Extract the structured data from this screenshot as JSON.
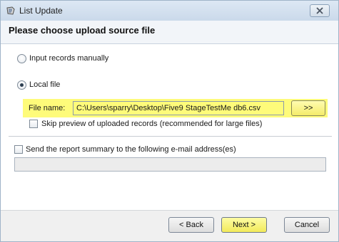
{
  "window": {
    "title": "List Update",
    "header": "Please choose upload source file"
  },
  "source": {
    "option_manual": "Input records manually",
    "option_local": "Local file",
    "selected": "Local file",
    "file_name_label": "File name:",
    "file_name_value": "C:\\Users\\sparry\\Desktop\\Five9 StageTestMe db6.csv",
    "browse_label": ">>",
    "skip_preview_label": "Skip preview of uploaded records (recommended for large files)",
    "skip_preview_checked": false
  },
  "report": {
    "send_summary_label": "Send the report summary to the following e-mail address(es)",
    "send_summary_checked": false,
    "email_value": ""
  },
  "footer": {
    "back_label": "< Back",
    "next_label": "Next >",
    "cancel_label": "Cancel"
  },
  "colors": {
    "highlight": "#fefb7a",
    "titlebar": "#cad9ea"
  },
  "icons": {
    "app": "list-update-icon",
    "close": "close-icon"
  }
}
